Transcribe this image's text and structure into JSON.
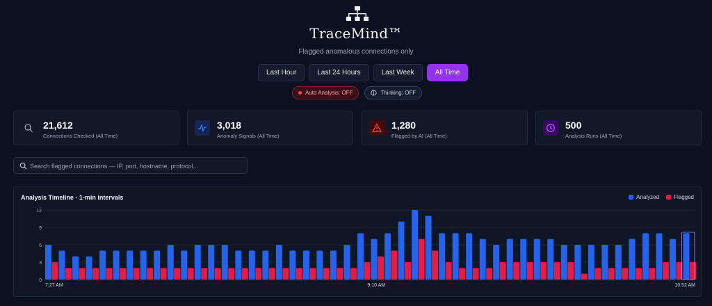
{
  "app": {
    "title": "TraceMind™",
    "logo_icon": "sitemap-icon",
    "subtitle": "Flagged anomalous connections only"
  },
  "time_tabs": [
    {
      "label": "Last Hour",
      "active": false
    },
    {
      "label": "Last 24 Hours",
      "active": false
    },
    {
      "label": "Last Week",
      "active": false
    },
    {
      "label": "All Time",
      "active": true
    }
  ],
  "toggles": {
    "auto_analysis": "Auto Analysis: OFF",
    "thinking": "Thinking: OFF"
  },
  "stats": [
    {
      "value": "21,612",
      "label": "Connections Checked (All Time)",
      "icon": "search-icon",
      "color": "#9ca3af"
    },
    {
      "value": "3,018",
      "label": "Anomaly Signals (All Time)",
      "icon": "activity-icon",
      "color": "#3b82f6"
    },
    {
      "value": "1,280",
      "label": "Flagged by AI (All Time)",
      "icon": "warning-icon",
      "color": "#ef4444"
    },
    {
      "value": "500",
      "label": "Analysis Runs (All Time)",
      "icon": "clock-icon",
      "color": "#a855f7"
    }
  ],
  "search": {
    "placeholder": "Search flagged connections — IP, port, hostname, protocol..."
  },
  "colors": {
    "accent": "#9333ea",
    "analyzed": "#2563eb",
    "flagged": "#e11d48"
  },
  "chart_data": {
    "type": "bar",
    "title": "Analysis Timeline · 1-min intervals",
    "yticks": [
      0,
      3,
      6,
      9,
      12
    ],
    "ylim": [
      0,
      12
    ],
    "xtick_labels": [
      "7:27 AM",
      "9:10 AM",
      "10:52 AM"
    ],
    "xtick_indices": [
      0,
      24,
      47
    ],
    "legend_position": "top-right",
    "series": [
      {
        "name": "Analyzed",
        "values": [
          6,
          5,
          4,
          4,
          5,
          5,
          5,
          5,
          5,
          6,
          5,
          6,
          6,
          6,
          5,
          5,
          5,
          6,
          5,
          5,
          5,
          5,
          6,
          8,
          7,
          8,
          10,
          12,
          11,
          8,
          8,
          8,
          7,
          6,
          7,
          7,
          7,
          7,
          6,
          6,
          6,
          6,
          6,
          7,
          8,
          8,
          7,
          8
        ]
      },
      {
        "name": "Flagged",
        "values": [
          3,
          2,
          2,
          2,
          2,
          2,
          2,
          2,
          2,
          2,
          2,
          2,
          2,
          2,
          2,
          2,
          2,
          2,
          2,
          2,
          2,
          2,
          2,
          3,
          4,
          5,
          3,
          7,
          5,
          3,
          2,
          2,
          2,
          3,
          3,
          3,
          3,
          3,
          3,
          1,
          2,
          2,
          2,
          2,
          2,
          3,
          3,
          3
        ]
      }
    ]
  }
}
